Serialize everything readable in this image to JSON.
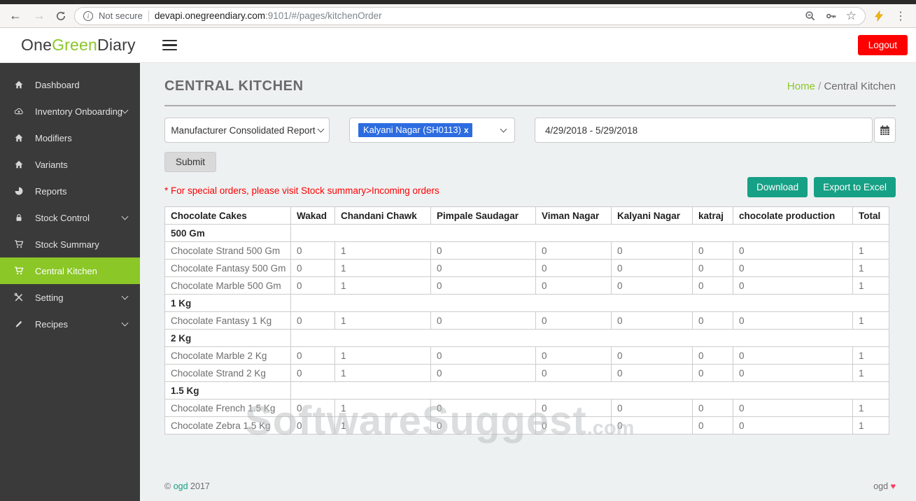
{
  "browser": {
    "security_label": "Not secure",
    "url_host": "devapi.onegreendiary.com",
    "url_rest": ":9101/#/pages/kitchenOrder"
  },
  "header": {
    "logo_part1": "One",
    "logo_part2": "Green",
    "logo_part3": "Diary",
    "logout_label": "Logout"
  },
  "sidebar": {
    "items": [
      {
        "label": "Dashboard",
        "icon": "home-icon",
        "expandable": false,
        "active": false
      },
      {
        "label": "Inventory Onboarding",
        "icon": "cloud-upload-icon",
        "expandable": true,
        "active": false
      },
      {
        "label": "Modifiers",
        "icon": "home-icon",
        "expandable": false,
        "active": false
      },
      {
        "label": "Variants",
        "icon": "home-icon",
        "expandable": false,
        "active": false
      },
      {
        "label": "Reports",
        "icon": "pie-chart-icon",
        "expandable": false,
        "active": false
      },
      {
        "label": "Stock Control",
        "icon": "lock-icon",
        "expandable": true,
        "active": false
      },
      {
        "label": "Stock Summary",
        "icon": "cart-icon",
        "expandable": false,
        "active": false
      },
      {
        "label": "Central Kitchen",
        "icon": "cart-icon",
        "expandable": false,
        "active": true
      },
      {
        "label": "Setting",
        "icon": "tools-icon",
        "expandable": true,
        "active": false
      },
      {
        "label": "Recipes",
        "icon": "pen-icon",
        "expandable": true,
        "active": false
      }
    ]
  },
  "page": {
    "title": "CENTRAL KITCHEN",
    "breadcrumb_home": "Home",
    "breadcrumb_sep": "/",
    "breadcrumb_current": "Central Kitchen"
  },
  "filters": {
    "report_select_value": "Manufacturer Consolidated Report",
    "store_tag_value": "Kalyani Nagar (SH0113)",
    "store_tag_remove": "x",
    "date_range_value": "4/29/2018 - 5/29/2018",
    "submit_label": "Submit",
    "note": "* For special orders, please visit Stock summary>Incoming orders",
    "download_label": "Download",
    "export_label": "Export to Excel"
  },
  "table": {
    "columns": [
      "Chocolate Cakes",
      "Wakad",
      "Chandani Chawk",
      "Pimpale Saudagar",
      "Viman Nagar",
      "Kalyani Nagar",
      "katraj",
      "chocolate production",
      "Total"
    ],
    "rows": [
      {
        "type": "section",
        "label": "500 Gm"
      },
      {
        "type": "data",
        "label": "Chocolate Strand 500 Gm",
        "values": [
          "0",
          "1",
          "0",
          "0",
          "0",
          "0",
          "0",
          "1"
        ]
      },
      {
        "type": "data",
        "label": "Chocolate Fantasy 500 Gm",
        "values": [
          "0",
          "1",
          "0",
          "0",
          "0",
          "0",
          "0",
          "1"
        ]
      },
      {
        "type": "data",
        "label": "Chocolate Marble 500 Gm",
        "values": [
          "0",
          "1",
          "0",
          "0",
          "0",
          "0",
          "0",
          "1"
        ]
      },
      {
        "type": "section",
        "label": "1 Kg"
      },
      {
        "type": "data",
        "label": "Chocolate Fantasy 1 Kg",
        "values": [
          "0",
          "1",
          "0",
          "0",
          "0",
          "0",
          "0",
          "1"
        ]
      },
      {
        "type": "section",
        "label": "2 Kg"
      },
      {
        "type": "data",
        "label": "Chocolate Marble 2 Kg",
        "values": [
          "0",
          "1",
          "0",
          "0",
          "0",
          "0",
          "0",
          "1"
        ]
      },
      {
        "type": "data",
        "label": "Chocolate Strand 2 Kg",
        "values": [
          "0",
          "1",
          "0",
          "0",
          "0",
          "0",
          "0",
          "1"
        ]
      },
      {
        "type": "section",
        "label": "1.5 Kg"
      },
      {
        "type": "data",
        "label": "Chocolate French 1.5 Kg",
        "values": [
          "0",
          "1",
          "0",
          "0",
          "0",
          "0",
          "0",
          "1"
        ]
      },
      {
        "type": "data",
        "label": "Chocolate Zebra 1.5 Kg",
        "values": [
          "0",
          "1",
          "0",
          "0",
          "0",
          "0",
          "0",
          "1"
        ]
      }
    ]
  },
  "watermark": {
    "text": "SoftwareSuggest",
    "suffix": ".com"
  },
  "footer": {
    "copyright_symbol": "©",
    "left_link": "ogd",
    "left_year": "2017",
    "right_text": "ogd",
    "heart": "♥"
  },
  "icons": {
    "browser": [
      "back-icon",
      "forward-icon",
      "reload-icon",
      "info-icon",
      "zoom-out-icon",
      "key-icon",
      "star-icon",
      "lightning-icon",
      "menu-dots-icon"
    ],
    "app": [
      "menu-icon",
      "chevron-down-icon",
      "calendar-icon",
      "home-icon",
      "cloud-upload-icon",
      "pie-chart-icon",
      "lock-icon",
      "cart-icon",
      "tools-icon",
      "pen-icon"
    ]
  },
  "colors": {
    "accent_green": "#8bc727",
    "teal_button": "#16a085",
    "tag_blue": "#2d6ce0",
    "logout_red": "#ff0000",
    "note_red": "#ff0000",
    "sidebar_bg": "#3a3a3a",
    "heart_pink": "#fb3c5e"
  }
}
